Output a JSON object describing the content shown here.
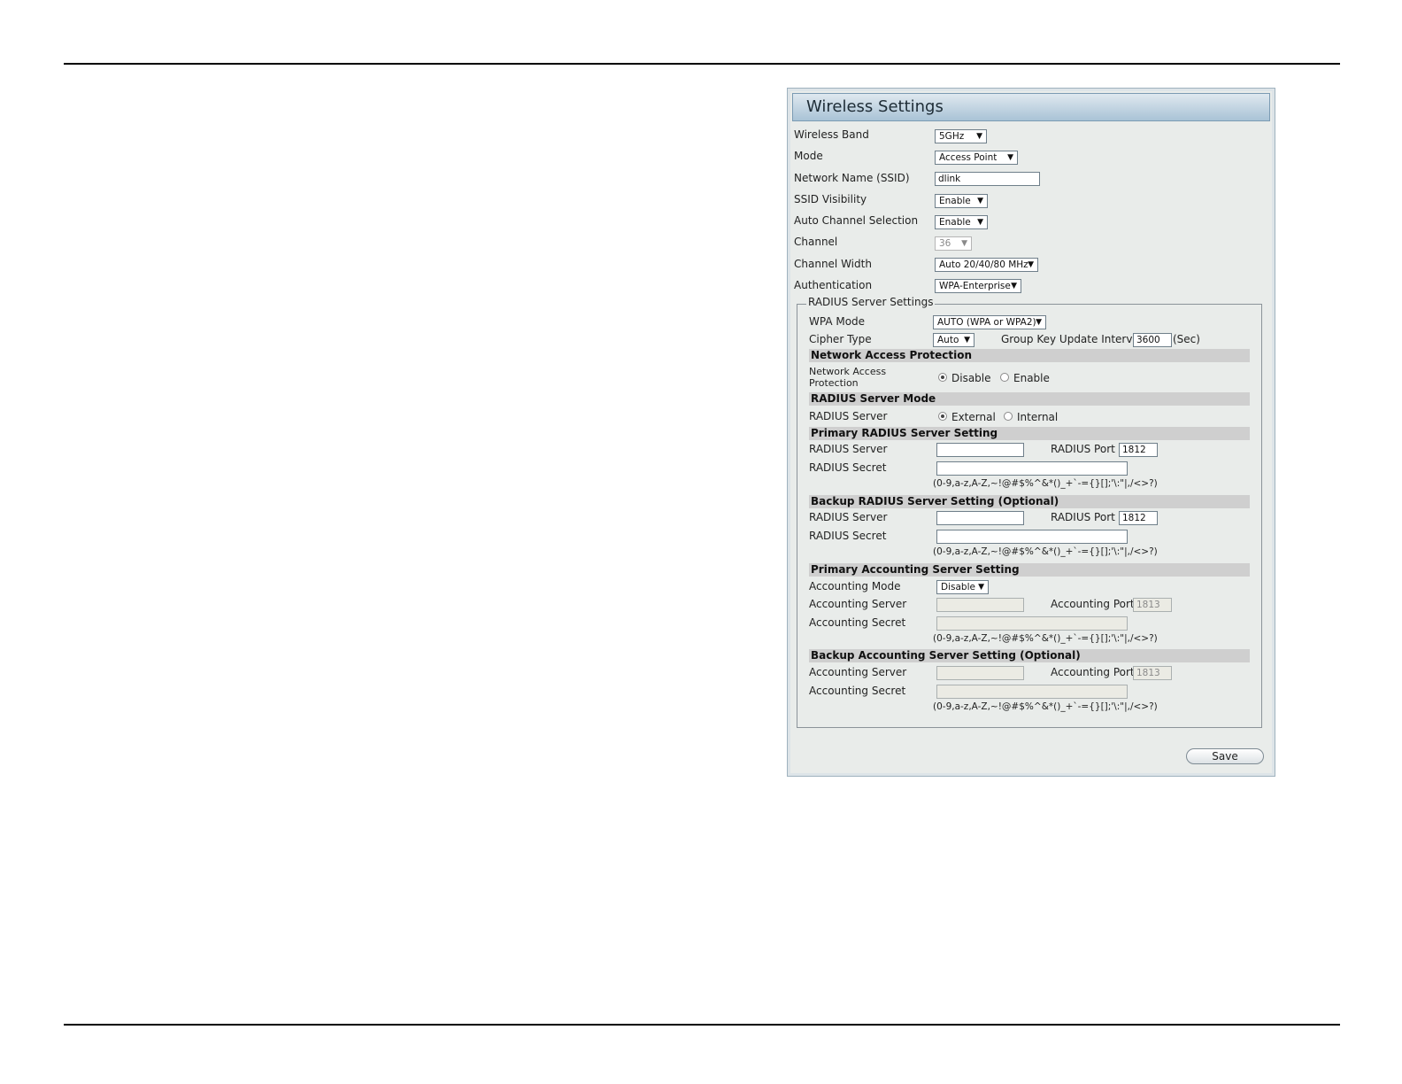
{
  "title": "Wireless Settings",
  "fields": {
    "wireless_band": {
      "label": "Wireless Band",
      "value": "5GHz"
    },
    "mode": {
      "label": "Mode",
      "value": "Access Point"
    },
    "ssid": {
      "label": "Network Name (SSID)",
      "value": "dlink"
    },
    "ssid_visibility": {
      "label": "SSID Visibility",
      "value": "Enable"
    },
    "auto_channel": {
      "label": "Auto Channel Selection",
      "value": "Enable"
    },
    "channel": {
      "label": "Channel",
      "value": "36"
    },
    "channel_width": {
      "label": "Channel Width",
      "value": "Auto 20/40/80 MHz"
    },
    "authentication": {
      "label": "Authentication",
      "value": "WPA-Enterprise"
    }
  },
  "radius": {
    "legend": "RADIUS Server Settings",
    "wpa_mode": {
      "label": "WPA Mode",
      "value": "AUTO (WPA or WPA2)"
    },
    "cipher_type": {
      "label": "Cipher Type",
      "value": "Auto"
    },
    "group_key": {
      "label": "Group Key Update Interval",
      "value": "3600",
      "unit": "(Sec)"
    },
    "nap_header": "Network Access Protection",
    "nap_label": "Network Access Protection",
    "nap_options": {
      "disable": "Disable",
      "enable": "Enable"
    },
    "mode_header": "RADIUS Server Mode",
    "mode_label": "RADIUS Server",
    "mode_options": {
      "external": "External",
      "internal": "Internal"
    },
    "primary_header": "Primary RADIUS Server Setting",
    "backup_header": "Backup RADIUS Server Setting (Optional)",
    "server_label": "RADIUS Server",
    "port_label": "RADIUS Port",
    "secret_label": "RADIUS Secret",
    "primary_port": "1812",
    "backup_port": "1812",
    "secret_hint": "(0-9,a-z,A-Z,~!@#$%^&*()_+`-={}[];'\\:\"|,/<>?)"
  },
  "accounting": {
    "primary_header": "Primary Accounting Server Setting",
    "backup_header": "Backup Accounting Server Setting (Optional)",
    "mode_label": "Accounting Mode",
    "mode_value": "Disable",
    "server_label": "Accounting Server",
    "port_label": "Accounting Port",
    "secret_label": "Accounting Secret",
    "primary_port": "1813",
    "backup_port": "1813"
  },
  "save_label": "Save"
}
